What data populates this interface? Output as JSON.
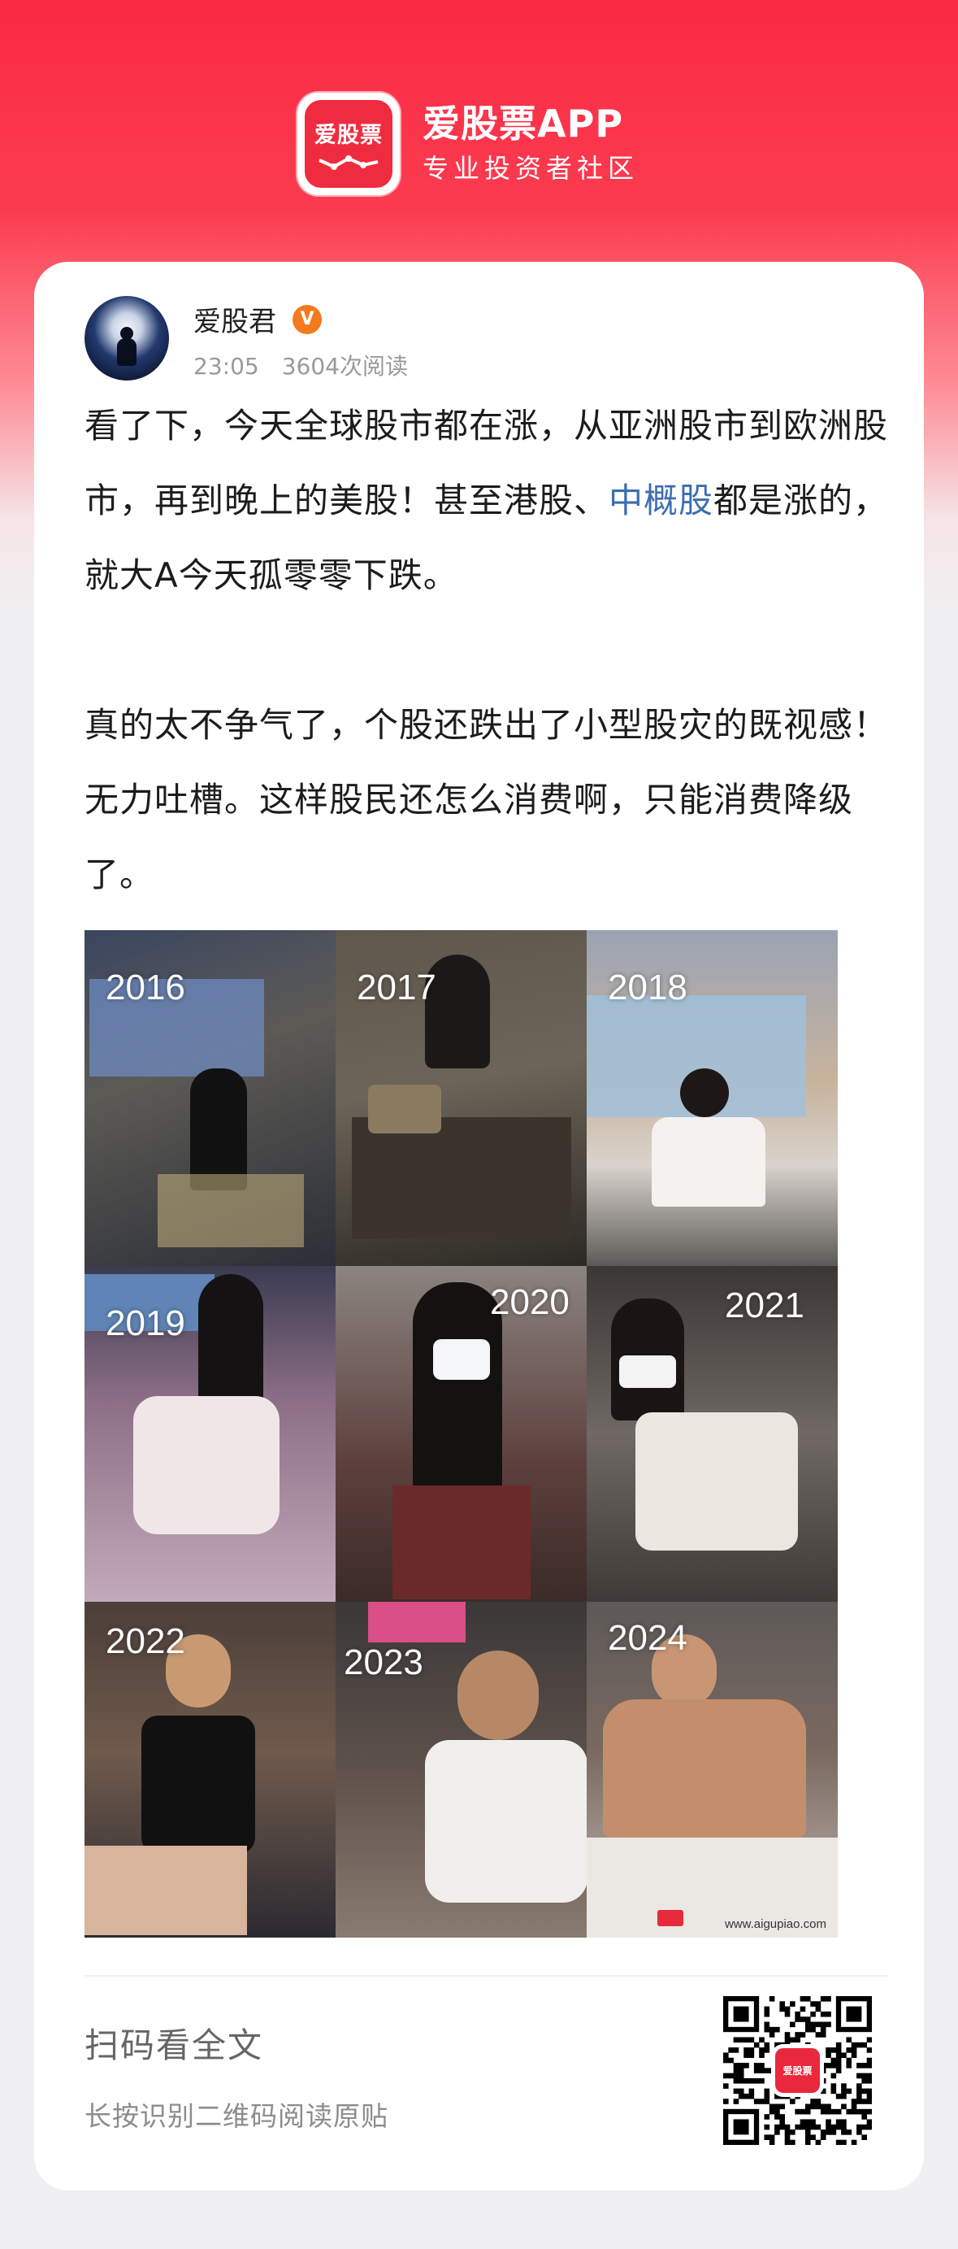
{
  "brand": {
    "logo_text": "爱股票",
    "name": "爱股票APP",
    "slogan": "专业投资者社区"
  },
  "post": {
    "author": "爱股君",
    "verified_badge": "V",
    "time": "23:05",
    "views": "3604次阅读",
    "paragraph1_before": "看了下，今天全球股市都在涨，从亚洲股市到欧洲股市，再到晚上的美股！甚至港股、",
    "paragraph1_link": "中概股",
    "paragraph1_after": "都是涨的，就大A今天孤零零下跌。",
    "paragraph2": "真的太不争气了，个股还跌出了小型股灾的既视感！无力吐槽。这样股民还怎么消费啊，只能消费降级了。",
    "images": [
      {
        "year": "2016"
      },
      {
        "year": "2017"
      },
      {
        "year": "2018"
      },
      {
        "year": "2019"
      },
      {
        "year": "2020"
      },
      {
        "year": "2021"
      },
      {
        "year": "2022"
      },
      {
        "year": "2023"
      },
      {
        "year": "2024"
      }
    ],
    "image_watermark": "www.aigupiao.com"
  },
  "footer": {
    "title": "扫码看全文",
    "subtitle": "长按识别二维码阅读原贴",
    "qr_logo_text": "爱股票"
  },
  "colors": {
    "brand_red": "#fa2a43",
    "link_blue": "#3c6db0",
    "badge_orange": "#f47a1d"
  }
}
